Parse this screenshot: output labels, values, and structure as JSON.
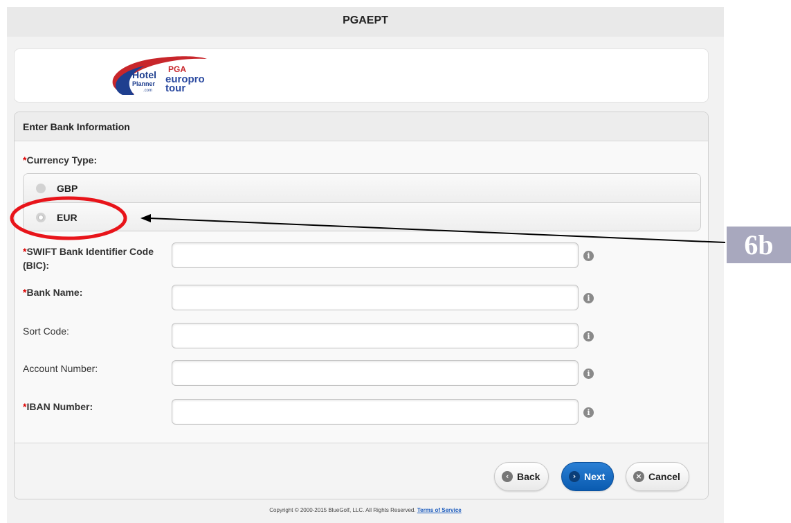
{
  "header": {
    "title": "PGAEPT"
  },
  "logo": {
    "brand_left_line1": "Hotel",
    "brand_left_line2": "Planner",
    "brand_left_suffix": ".com",
    "brand_right_line1": "PGA",
    "brand_right_line2": "europro",
    "brand_right_line3": "tour"
  },
  "form": {
    "heading": "Enter Bank Information",
    "required_mark": "*",
    "currency": {
      "label": "Currency Type:",
      "options": [
        {
          "label": "GBP",
          "checked": false
        },
        {
          "label": "EUR",
          "checked": true
        }
      ]
    },
    "fields": [
      {
        "label": "SWIFT Bank Identifier Code (BIC):",
        "required": true,
        "value": ""
      },
      {
        "label": "Bank Name:",
        "required": true,
        "value": ""
      },
      {
        "label": "Sort Code:",
        "required": false,
        "value": ""
      },
      {
        "label": "Account Number:",
        "required": false,
        "value": ""
      },
      {
        "label": "IBAN Number:",
        "required": true,
        "value": ""
      }
    ],
    "info_icon": "i"
  },
  "buttons": {
    "back": "Back",
    "next": "Next",
    "cancel": "Cancel"
  },
  "footer": {
    "copyright": "Copyright © 2000-2015 BlueGolf, LLC. All Rights Reserved.",
    "terms": "Terms of Service"
  },
  "annotation": {
    "label": "6b",
    "highlight_color": "#e8141a"
  }
}
